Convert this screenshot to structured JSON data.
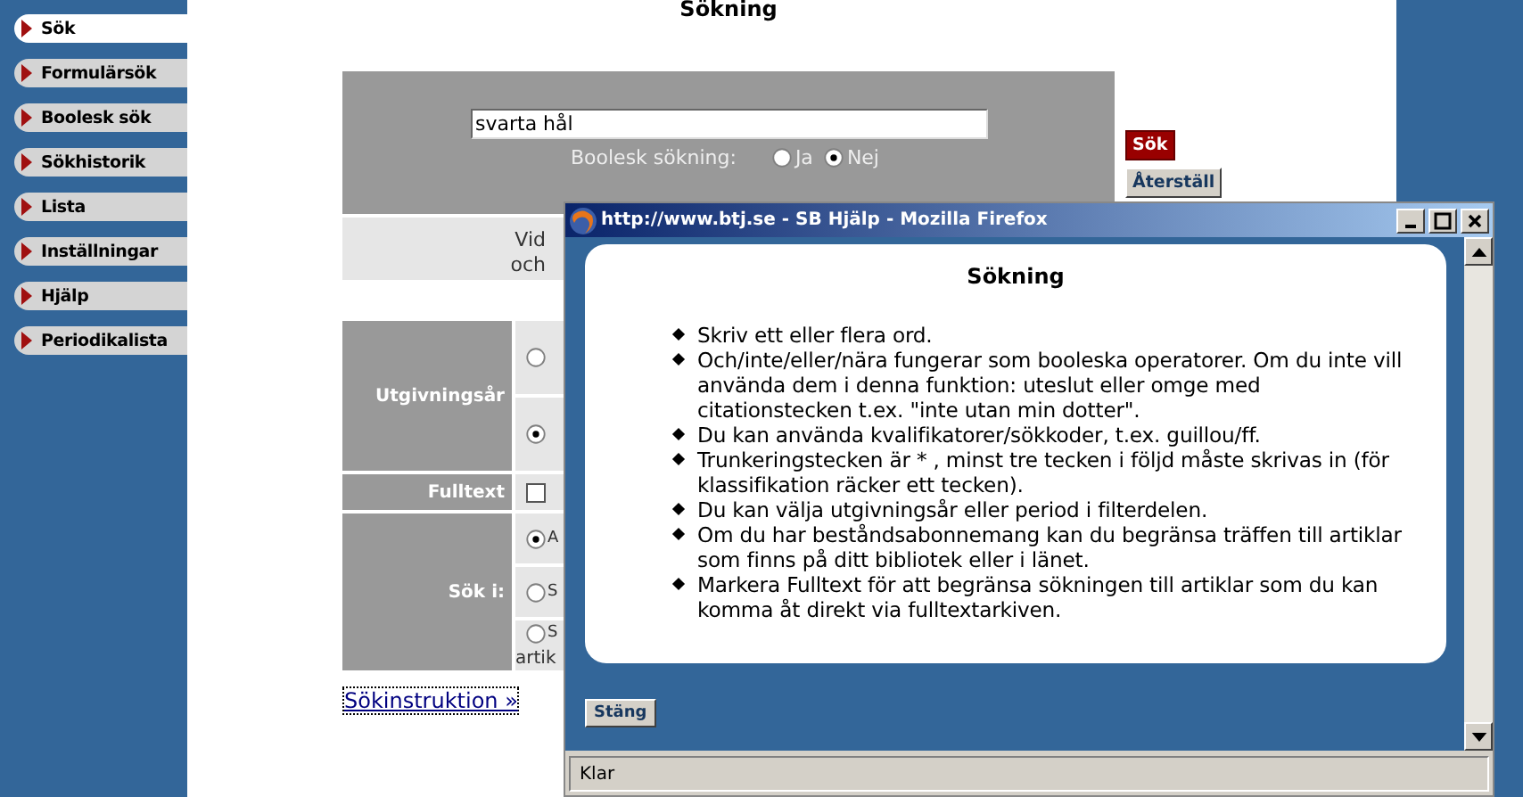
{
  "sidebar": {
    "items": [
      {
        "label": "Sök",
        "selected": true
      },
      {
        "label": "Formulärsök",
        "selected": false
      },
      {
        "label": "Boolesk sök",
        "selected": false
      },
      {
        "label": "Sökhistorik",
        "selected": false
      },
      {
        "label": "Lista",
        "selected": false
      },
      {
        "label": "Inställningar",
        "selected": false
      },
      {
        "label": "Hjälp",
        "selected": false
      },
      {
        "label": "Periodikalista",
        "selected": false
      }
    ]
  },
  "page_title": "Sökning",
  "search": {
    "value": "svarta hål",
    "boolean_label": "Boolesk sökning:",
    "boolean_options": [
      {
        "label": "Ja",
        "selected": false
      },
      {
        "label": "Nej",
        "selected": true
      }
    ]
  },
  "buttons": [
    {
      "label": "Sök",
      "kind": "primary"
    },
    {
      "label": "Återställ",
      "kind": "secondary"
    }
  ],
  "notice_lines": [
    "Vid",
    "och"
  ],
  "filters": [
    {
      "label": "Utgivningsår",
      "options": [
        {
          "kind": "radio",
          "selected": false
        },
        {
          "kind": "radio",
          "selected": true
        }
      ]
    },
    {
      "label": "Fulltext",
      "options": [
        {
          "kind": "checkbox",
          "checked": false
        }
      ]
    },
    {
      "label": "Sök i:",
      "options": [
        {
          "kind": "radio",
          "selected": true,
          "label": "A"
        },
        {
          "kind": "radio",
          "selected": false,
          "label": "S"
        },
        {
          "kind": "radio",
          "selected": false,
          "label": "S",
          "sublabel": "artik"
        }
      ]
    }
  ],
  "instruction_link": "Sökinstruktion »",
  "popup": {
    "title": "http://www.btj.se - SB Hjälp - Mozilla Firefox",
    "heading": "Sökning",
    "items": [
      "Skriv ett eller flera ord.",
      "Och/inte/eller/nära fungerar som booleska operatorer. Om du inte vill använda dem i denna funktion: uteslut eller omge med citationstecken t.ex. \"inte utan min dotter\".",
      "Du kan använda kvalifikatorer/sökkoder, t.ex. guillou/ff.",
      "Trunkeringstecken är * , minst tre tecken i följd måste skrivas in (för klassifikation räcker ett tecken).",
      "Du kan välja utgivningsår eller period i filterdelen.",
      "Om du har beståndsabonnemang kan du begränsa träffen till artiklar som finns på ditt bibliotek eller i länet.",
      "Markera Fulltext för att begränsa sökningen till artiklar som du kan komma åt direkt via fulltextarkiven."
    ],
    "close_button": "Stäng",
    "status_bar": "Klar"
  }
}
